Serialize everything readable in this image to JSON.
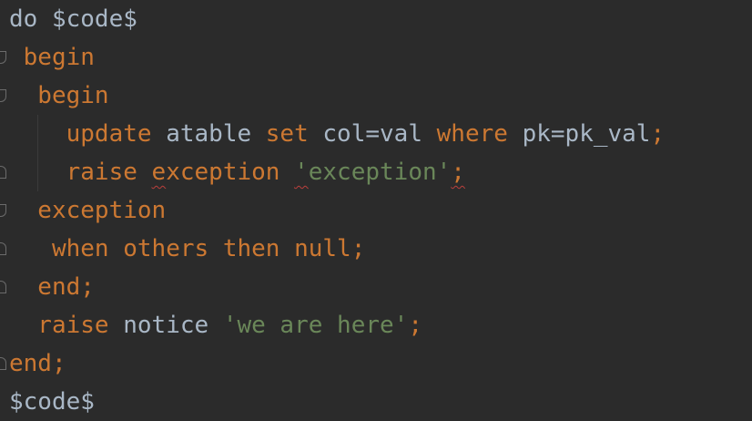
{
  "code_lines": [
    [
      {
        "t": "do ",
        "c": "plain"
      },
      {
        "t": "$code$",
        "c": "plain"
      }
    ],
    [
      {
        "t": " begin",
        "c": "kw"
      }
    ],
    [
      {
        "t": "  begin",
        "c": "kw"
      }
    ],
    [
      {
        "t": "    update",
        "c": "kw"
      },
      {
        "t": " atable ",
        "c": "id"
      },
      {
        "t": "set",
        "c": "kw"
      },
      {
        "t": " col=val ",
        "c": "id"
      },
      {
        "t": "where",
        "c": "kw"
      },
      {
        "t": " pk=pk_val",
        "c": "id"
      },
      {
        "t": ";",
        "c": "punct"
      }
    ],
    [
      {
        "t": "    raise",
        "c": "kw"
      },
      {
        "t": " exception ",
        "c": "kw"
      },
      {
        "t": "'exception'",
        "c": "str"
      },
      {
        "t": ";",
        "c": "punct"
      }
    ],
    [
      {
        "t": "  exception",
        "c": "kw"
      }
    ],
    [
      {
        "t": "   when",
        "c": "kw"
      },
      {
        "t": " others ",
        "c": "kw"
      },
      {
        "t": "then",
        "c": "kw"
      },
      {
        "t": " null",
        "c": "kw"
      },
      {
        "t": ";",
        "c": "punct"
      }
    ],
    [
      {
        "t": "  end",
        "c": "kw"
      },
      {
        "t": ";",
        "c": "punct"
      }
    ],
    [
      {
        "t": "  raise",
        "c": "kw"
      },
      {
        "t": " notice ",
        "c": "id"
      },
      {
        "t": "'we are here'",
        "c": "str"
      },
      {
        "t": ";",
        "c": "punct"
      }
    ],
    [
      {
        "t": "end",
        "c": "kw"
      },
      {
        "t": ";",
        "c": "punct"
      }
    ],
    [
      {
        "t": "$code$",
        "c": "plain"
      }
    ]
  ],
  "fold_markers": [
    "open",
    "open",
    "close",
    "open",
    "close",
    "close",
    "close"
  ],
  "colors": {
    "background": "#2b2b2b",
    "keyword": "#cc7832",
    "identifier": "#a9b7c6",
    "string": "#6a8759",
    "warning_underline": "#bc3f3c"
  }
}
